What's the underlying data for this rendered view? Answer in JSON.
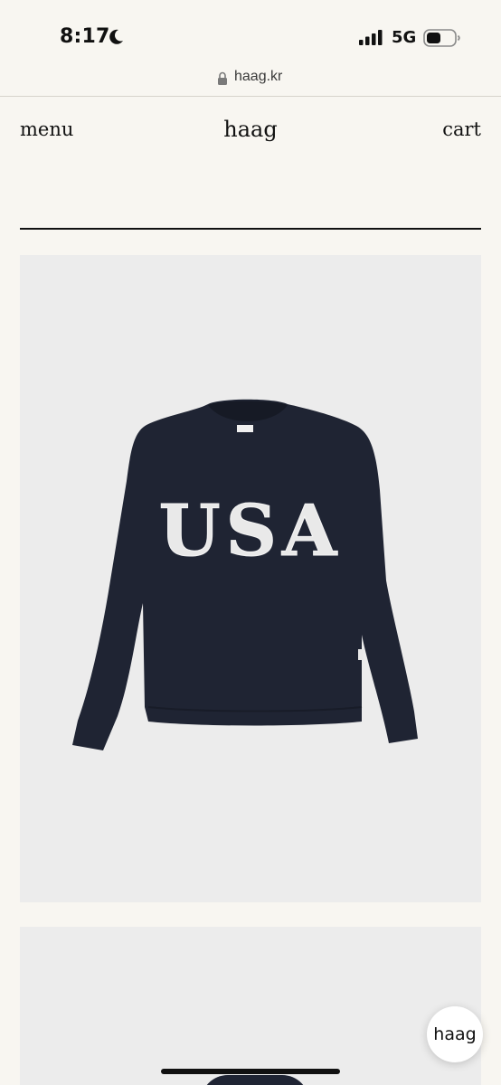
{
  "status_bar": {
    "time": "8:17",
    "network": "5G",
    "icons": [
      "moon-icon",
      "signal-icon",
      "battery-icon"
    ]
  },
  "browser": {
    "url": "haag.kr",
    "icons": [
      "lock-icon"
    ]
  },
  "header": {
    "menu_label": "menu",
    "brand": "haag",
    "cart_label": "cart"
  },
  "product": {
    "graphic_text": "USA",
    "garment_color": "#1f2433",
    "letter_color": "#e9e9e9",
    "card_bg": "#ececec"
  },
  "chat_widget": {
    "label": "haag"
  },
  "colors": {
    "page_bg": "#f8f6f1",
    "text": "#111111"
  }
}
